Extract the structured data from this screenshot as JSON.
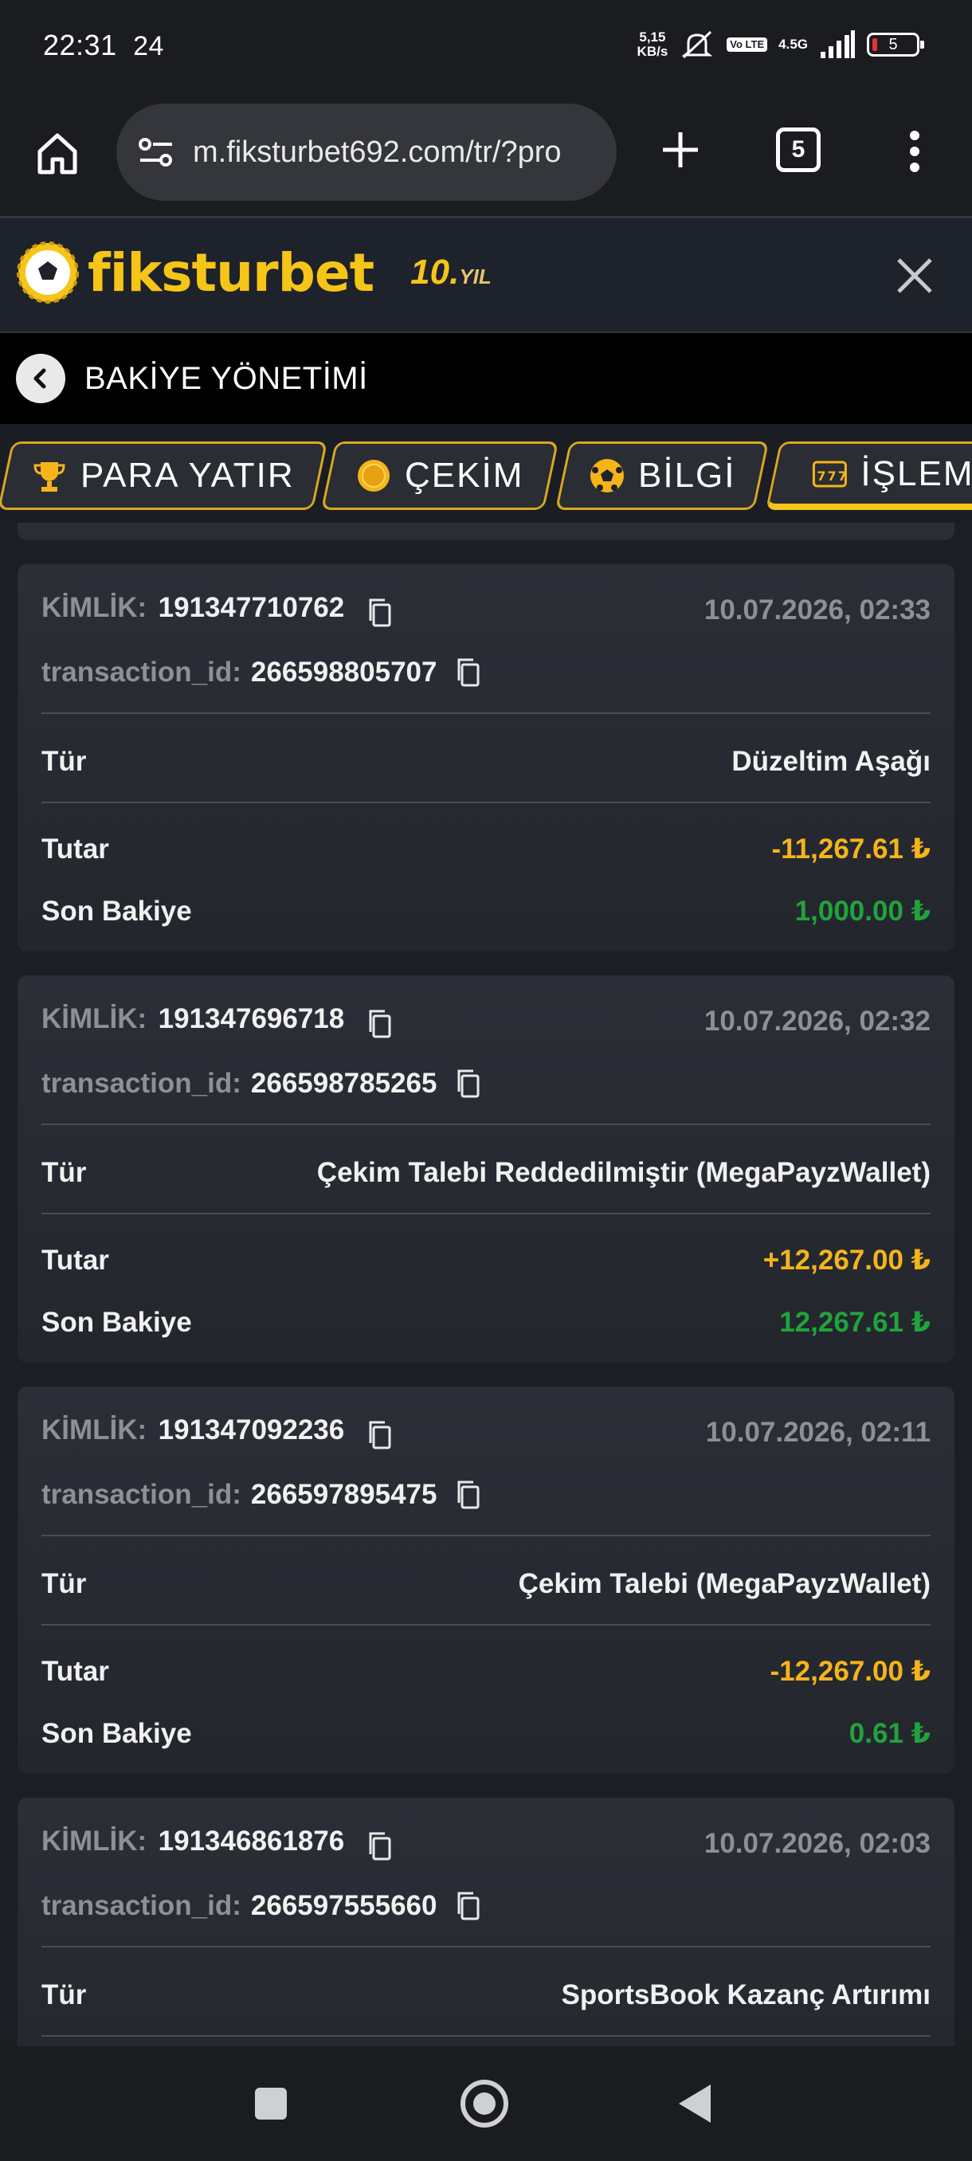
{
  "status_bar": {
    "time": "22:31",
    "notif_count": "24",
    "net_speed_value": "5,15",
    "net_speed_unit": "KB/s",
    "volte_label": "Vo LTE",
    "network": "4.5G",
    "battery": "5"
  },
  "browser": {
    "url": "m.fiksturbet692.com/tr/?pro",
    "tab_count": "5"
  },
  "site": {
    "logo_text": "fiksturbet",
    "anniversary_number": "10.",
    "anniversary_suffix": "YIL"
  },
  "page": {
    "title": "BAKİYE YÖNETİMİ"
  },
  "tabs": [
    {
      "label": "PARA YATIR",
      "icon": "trophy-icon"
    },
    {
      "label": "ÇEKİM",
      "icon": "coin-icon"
    },
    {
      "label": "BİLGİ",
      "icon": "soccer-ball-icon"
    },
    {
      "label": "İŞLEM",
      "icon": "slot-machine-icon"
    }
  ],
  "labels": {
    "id_label": "KİMLİK:",
    "tx_label": "transaction_id:",
    "type_label": "Tür",
    "amount_label": "Tutar",
    "balance_label": "Son Bakiye"
  },
  "transactions": [
    {
      "id": "191347710762",
      "date": "10.07.2026, 02:33",
      "transaction_id": "266598805707",
      "type": "Düzeltim Aşağı",
      "amount": "-11,267.61 ₺",
      "balance": "1,000.00 ₺"
    },
    {
      "id": "191347696718",
      "date": "10.07.2026, 02:32",
      "transaction_id": "266598785265",
      "type": "Çekim Talebi Reddedilmiştir (MegaPayzWallet)",
      "amount": "+12,267.00 ₺",
      "balance": "12,267.61 ₺"
    },
    {
      "id": "191347092236",
      "date": "10.07.2026, 02:11",
      "transaction_id": "266597895475",
      "type": "Çekim Talebi (MegaPayzWallet)",
      "amount": "-12,267.00 ₺",
      "balance": "0.61 ₺"
    },
    {
      "id": "191346861876",
      "date": "10.07.2026, 02:03",
      "transaction_id": "266597555660",
      "type": "SportsBook Kazanç Artırımı"
    }
  ],
  "colors": {
    "accent_yellow": "#f5c518",
    "amount_yellow": "#f5b41a",
    "balance_green": "#21a33c",
    "card_bg": "#2b2e36",
    "page_bg": "#1c1e24"
  }
}
